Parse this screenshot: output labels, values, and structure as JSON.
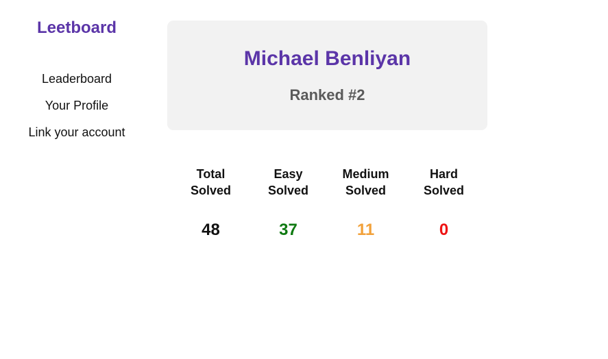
{
  "brand": "Leetboard",
  "nav": {
    "leaderboard": "Leaderboard",
    "profile": "Your Profile",
    "link_account": "Link your account"
  },
  "profile": {
    "name": "Michael Benliyan",
    "rank": "Ranked #2"
  },
  "stats": [
    {
      "label_line1": "Total",
      "label_line2": "Solved",
      "value": "48",
      "color": "#111111"
    },
    {
      "label_line1": "Easy",
      "label_line2": "Solved",
      "value": "37",
      "color": "#0f7a12"
    },
    {
      "label_line1": "Medium",
      "label_line2": "Solved",
      "value": "11",
      "color": "#f2a13a"
    },
    {
      "label_line1": "Hard",
      "label_line2": "Solved",
      "value": "0",
      "color": "#ee1313"
    }
  ],
  "colors": {
    "accent": "#5b35a8",
    "card_bg": "#f2f2f2",
    "rank_text": "#5a5a5a"
  }
}
